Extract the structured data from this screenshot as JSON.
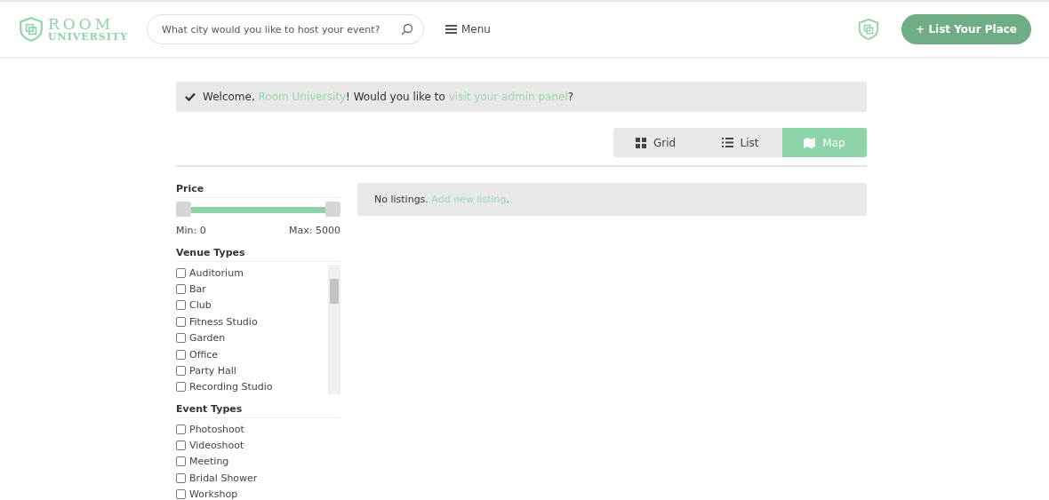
{
  "header": {
    "logo": {
      "line1": "ROOM",
      "line2": "UNIVERSITY"
    },
    "search": {
      "placeholder": "What city would you like to host your event?"
    },
    "menu": "Menu",
    "cta": "+ List Your Place"
  },
  "welcome": {
    "parts": [
      {
        "kind": "text",
        "text": "Welcome, "
      },
      {
        "kind": "link",
        "text": "Room University"
      },
      {
        "kind": "text",
        "text": "! Would you like to "
      },
      {
        "kind": "link",
        "text": "visit your admin panel"
      },
      {
        "kind": "text",
        "text": "?"
      }
    ]
  },
  "views": [
    {
      "label": "Grid",
      "kind": "grid",
      "selected": false
    },
    {
      "label": "List",
      "kind": "list",
      "selected": false
    },
    {
      "label": "Map",
      "kind": "map",
      "selected": true
    }
  ],
  "filters": {
    "price": {
      "title": "Price",
      "level": 1,
      "min": "Min: 0",
      "max": "Max: 5000"
    },
    "venue_types": {
      "title": "Venue Types",
      "items": [
        {
          "label": "Auditorium",
          "checked": false
        },
        {
          "label": "Bar",
          "checked": false
        },
        {
          "label": "Club",
          "checked": false
        },
        {
          "label": "Fitness Studio",
          "checked": false
        },
        {
          "label": "Garden",
          "checked": false
        },
        {
          "label": "Office",
          "checked": false
        },
        {
          "label": "Party Hall",
          "checked": false
        },
        {
          "label": "Recording Studio",
          "checked": false
        }
      ]
    },
    "event_types": {
      "title": "Event Types",
      "items": [
        {
          "label": "Photoshoot",
          "checked": false
        },
        {
          "label": "Videoshoot",
          "checked": false
        },
        {
          "label": "Meeting",
          "checked": false
        },
        {
          "label": "Bridal Shower",
          "checked": false
        },
        {
          "label": "Workshop",
          "checked": false
        }
      ]
    }
  },
  "listings": {
    "message": "No listings. ",
    "link": "Add new listing",
    "end": "."
  }
}
